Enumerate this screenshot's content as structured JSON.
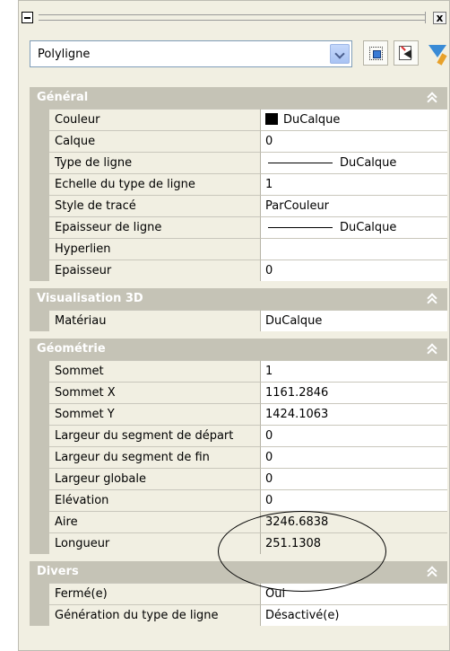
{
  "selection": {
    "value": "Polyligne"
  },
  "toolbar": {
    "close_label": "x",
    "buttons": [
      {
        "icon": "pickadd-toggle-icon"
      },
      {
        "icon": "select-objects-icon"
      },
      {
        "icon": "quick-select-filter-icon"
      }
    ]
  },
  "sections": {
    "general": {
      "title": "Général",
      "rows": {
        "couleur": {
          "label": "Couleur",
          "value": "DuCalque"
        },
        "calque": {
          "label": "Calque",
          "value": "0"
        },
        "type_ligne": {
          "label": "Type de ligne",
          "value": "DuCalque"
        },
        "echelle": {
          "label": "Echelle du type de ligne",
          "value": "1"
        },
        "style_trace": {
          "label": "Style de tracé",
          "value": "ParCouleur"
        },
        "epaisseur_ligne": {
          "label": "Epaisseur de ligne",
          "value": "DuCalque"
        },
        "hyperlien": {
          "label": "Hyperlien",
          "value": ""
        },
        "epaisseur": {
          "label": "Epaisseur",
          "value": "0"
        }
      }
    },
    "visu3d": {
      "title": "Visualisation 3D",
      "rows": {
        "materiau": {
          "label": "Matériau",
          "value": "DuCalque"
        }
      }
    },
    "geometrie": {
      "title": "Géométrie",
      "rows": {
        "sommet": {
          "label": "Sommet",
          "value": "1"
        },
        "sommet_x": {
          "label": "Sommet X",
          "value": "1161.2846"
        },
        "sommet_y": {
          "label": "Sommet Y",
          "value": "1424.1063"
        },
        "larg_depart": {
          "label": "Largeur du segment de départ",
          "value": "0"
        },
        "larg_fin": {
          "label": "Largeur du segment de fin",
          "value": "0"
        },
        "larg_globale": {
          "label": "Largeur globale",
          "value": "0"
        },
        "elevation": {
          "label": "Elévation",
          "value": "0"
        },
        "aire": {
          "label": "Aire",
          "value": "3246.6838"
        },
        "longueur": {
          "label": "Longueur",
          "value": "251.1308"
        }
      }
    },
    "divers": {
      "title": "Divers",
      "rows": {
        "ferme": {
          "label": "Fermé(e)",
          "value": "Oui"
        },
        "generation": {
          "label": "Génération du type de ligne",
          "value": "Désactivé(e)"
        }
      }
    }
  },
  "colors": {
    "header": "#c5c3b6",
    "panel": "#f1efe2",
    "swatch": "#000000"
  }
}
